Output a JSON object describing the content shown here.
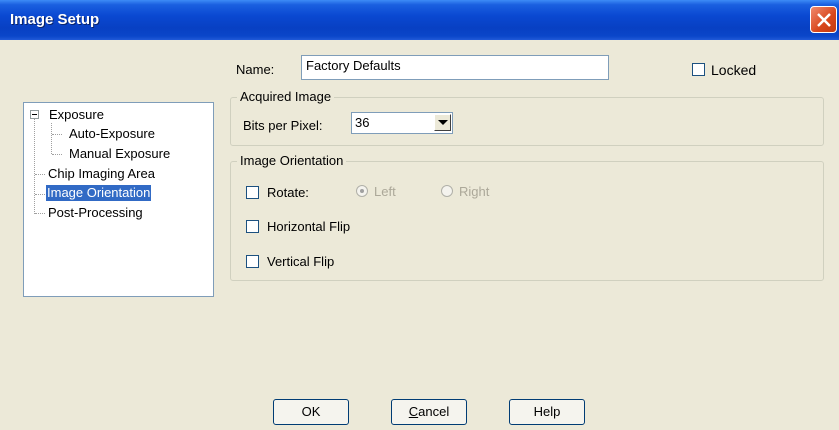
{
  "window": {
    "title": "Image Setup"
  },
  "name_field": {
    "label": "Name:",
    "value": "Factory Defaults"
  },
  "locked": {
    "label": "Locked",
    "checked": false
  },
  "tree": {
    "exposure": "Exposure",
    "auto_exposure": "Auto-Exposure",
    "manual_exposure": "Manual Exposure",
    "chip_imaging_area": "Chip Imaging Area",
    "image_orientation": "Image Orientation",
    "post_processing": "Post-Processing",
    "selected": "Image Orientation"
  },
  "acquired_image": {
    "title": "Acquired Image",
    "bits_label": "Bits per Pixel:",
    "bits_value": "36"
  },
  "image_orientation": {
    "title": "Image Orientation",
    "rotate_label": "Rotate:",
    "left_label": "Left",
    "right_label": "Right",
    "horizontal_flip_label": "Horizontal Flip",
    "vertical_flip_label": "Vertical Flip"
  },
  "buttons": {
    "ok": "OK",
    "cancel_first": "C",
    "cancel_rest": "ancel",
    "help": "Help"
  }
}
